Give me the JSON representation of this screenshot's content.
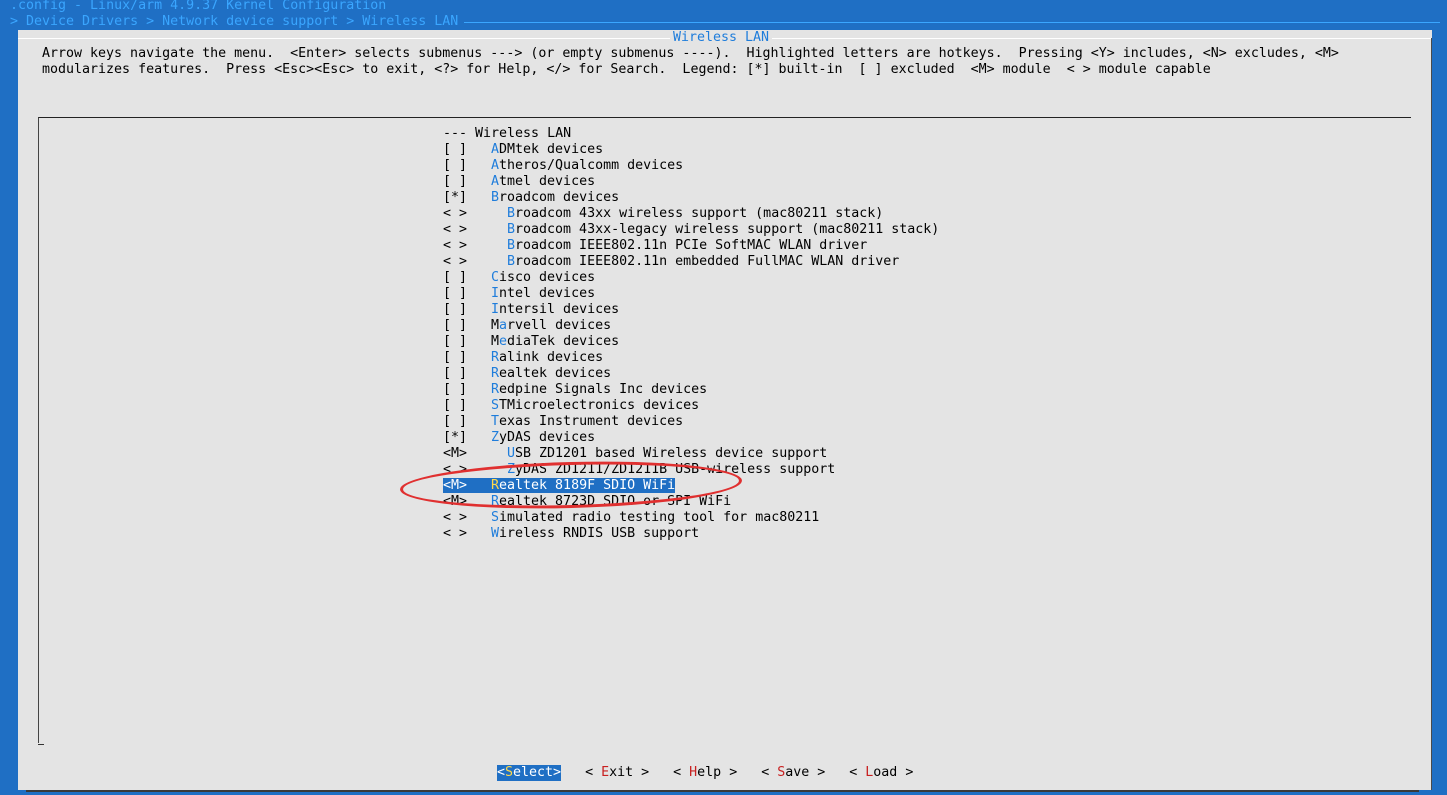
{
  "title": ".config - Linux/arm 4.9.37 Kernel Configuration",
  "breadcrumb": "> Device Drivers > Network device support > Wireless LAN",
  "dialog": {
    "title": "Wireless LAN",
    "help_line1": "Arrow keys navigate the menu.  <Enter> selects submenus ---> (or empty submenus ----).  Highlighted letters are hotkeys.  Pressing <Y> includes, <N> excludes, <M>",
    "help_line2": "modularizes features.  Press <Esc><Esc> to exit, <?> for Help, </> for Search.  Legend: [*] built-in  [ ] excluded  <M> module  < > module capable"
  },
  "menu": {
    "header": "--- Wireless LAN",
    "items": [
      {
        "sel": "[ ]",
        "hk": "A",
        "rest": "DMtek devices",
        "indent": false
      },
      {
        "sel": "[ ]",
        "hk": "A",
        "rest": "theros/Qualcomm devices",
        "indent": false
      },
      {
        "sel": "[ ]",
        "hk": "A",
        "rest": "tmel devices",
        "indent": false
      },
      {
        "sel": "[*]",
        "hk": "B",
        "rest": "roadcom devices",
        "indent": false
      },
      {
        "sel": "< >",
        "hk": "B",
        "rest": "roadcom 43xx wireless support (mac80211 stack)",
        "indent": true
      },
      {
        "sel": "< >",
        "hk": "B",
        "rest": "roadcom 43xx-legacy wireless support (mac80211 stack)",
        "indent": true
      },
      {
        "sel": "< >",
        "hk": "B",
        "rest": "roadcom IEEE802.11n PCIe SoftMAC WLAN driver",
        "indent": true
      },
      {
        "sel": "< >",
        "hk": "B",
        "rest": "roadcom IEEE802.11n embedded FullMAC WLAN driver",
        "indent": true
      },
      {
        "sel": "[ ]",
        "hk": "C",
        "rest": "isco devices",
        "indent": false
      },
      {
        "sel": "[ ]",
        "hk": "I",
        "rest": "ntel devices",
        "indent": false
      },
      {
        "sel": "[ ]",
        "hk": "I",
        "rest": "ntersil devices",
        "indent": false
      },
      {
        "sel": "[ ]",
        "pre": "M",
        "hk": "a",
        "rest": "rvell devices",
        "indent": false
      },
      {
        "sel": "[ ]",
        "pre": "M",
        "hk": "e",
        "rest": "diaTek devices",
        "indent": false
      },
      {
        "sel": "[ ]",
        "hk": "R",
        "rest": "alink devices",
        "indent": false
      },
      {
        "sel": "[ ]",
        "hk": "R",
        "rest": "ealtek devices",
        "indent": false
      },
      {
        "sel": "[ ]",
        "hk": "R",
        "rest": "edpine Signals Inc devices",
        "indent": false
      },
      {
        "sel": "[ ]",
        "hk": "S",
        "rest": "TMicroelectronics devices",
        "indent": false
      },
      {
        "sel": "[ ]",
        "hk": "T",
        "rest": "exas Instrument devices",
        "indent": false
      },
      {
        "sel": "[*]",
        "hk": "Z",
        "rest": "yDAS devices",
        "indent": false
      },
      {
        "sel": "<M>",
        "hk": "U",
        "rest": "SB ZD1201 based Wireless device support",
        "indent": true
      },
      {
        "sel": "< >",
        "hk": "Z",
        "rest": "yDAS ZD1211/ZD1211B USB-wireless support",
        "indent": true
      },
      {
        "sel": "<M>",
        "hk": "R",
        "rest": "ealtek 8189F SDIO WiFi",
        "indent": false,
        "selected": true
      },
      {
        "sel": "<M>",
        "hk": "R",
        "rest": "ealtek 8723D SDIO or SPI WiFi",
        "indent": false
      },
      {
        "sel": "< >",
        "hk": "S",
        "rest": "imulated radio testing tool for mac80211",
        "indent": false
      },
      {
        "sel": "< >",
        "hk": "W",
        "rest": "ireless RNDIS USB support",
        "indent": false
      }
    ]
  },
  "buttons": [
    {
      "pre": "<",
      "hk": "S",
      "rest": "elect>",
      "active": true
    },
    {
      "pre": "< ",
      "hk": "E",
      "rest": "xit >",
      "active": false
    },
    {
      "pre": "< ",
      "hk": "H",
      "rest": "elp >",
      "active": false
    },
    {
      "pre": "< ",
      "hk": "S",
      "rest": "ave >",
      "active": false
    },
    {
      "pre": "< ",
      "hk": "L",
      "rest": "oad >",
      "active": false
    }
  ],
  "colors": {
    "background": "#1f6fc4",
    "dialog": "#e4e4e4",
    "hotkey": "#1f7ddb",
    "selection": "#1f6fc4",
    "annotation": "#e03030"
  }
}
